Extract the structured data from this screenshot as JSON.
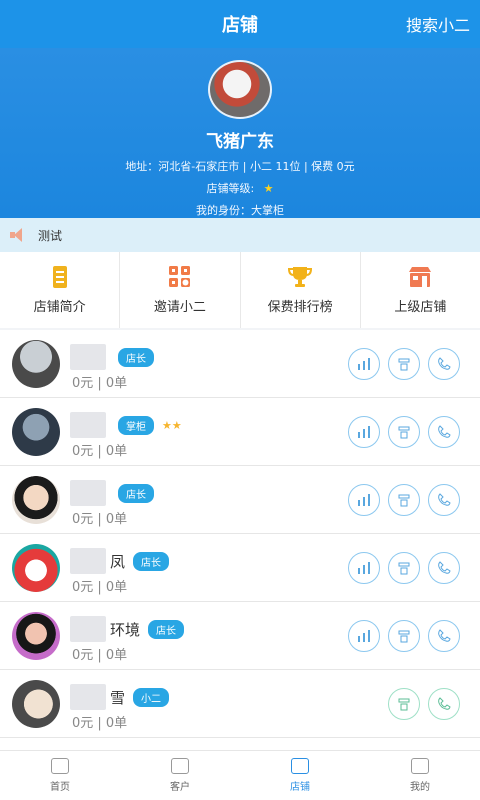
{
  "header": {
    "title": "店铺",
    "right_action": "搜索小二"
  },
  "store": {
    "name": "飞猪广东",
    "address_line": "地址：河北省-石家庄市 | 小二 11位 | 保费 0元",
    "level_label": "店铺等级:",
    "level_star": "★",
    "identity_line": "我的身份：大掌柜"
  },
  "notice": {
    "text": "测试"
  },
  "menu": {
    "items": [
      {
        "label": "店铺简介",
        "icon": "doc-icon",
        "color": "#f0b21d"
      },
      {
        "label": "邀请小二",
        "icon": "qr-icon",
        "color": "#f17b47"
      },
      {
        "label": "保费排行榜",
        "icon": "trophy-icon",
        "color": "#f2b21a"
      },
      {
        "label": "上级店铺",
        "icon": "store-icon",
        "color": "#f07a52"
      }
    ]
  },
  "members": [
    {
      "name_visible": "",
      "role": "店长",
      "stars": "",
      "amount": "0元 | 0单",
      "avatar_colors": [
        "#999",
        "#333"
      ]
    },
    {
      "name_visible": "",
      "role": "掌柜",
      "stars": "★★",
      "amount": "0元 | 0单",
      "avatar_colors": [
        "#8ea1b3",
        "#2e3a48"
      ]
    },
    {
      "name_visible": "",
      "role": "店长",
      "stars": "",
      "amount": "0元 | 0单",
      "avatar_colors": [
        "#f3d8c3",
        "#1b1b1b"
      ]
    },
    {
      "name_visible": "凤",
      "role": "店长",
      "stars": "",
      "amount": "0元 | 0单",
      "avatar_colors": [
        "#e53b3b",
        "#ffffff"
      ]
    },
    {
      "name_visible": "环境",
      "role": "店长",
      "stars": "",
      "amount": "0元 | 0单",
      "avatar_colors": [
        "#c56cc9",
        "#171717"
      ]
    },
    {
      "name_visible": "雪",
      "role": "小二",
      "stars": "",
      "amount": "0元 | 0单",
      "avatar_colors": [
        "#f1e2d2",
        "#4a4a4a"
      ]
    }
  ],
  "tabs": [
    {
      "label": "首页",
      "icon": "home-icon"
    },
    {
      "label": "客户",
      "icon": "customers-icon"
    },
    {
      "label": "店铺",
      "icon": "store-icon"
    },
    {
      "label": "我的",
      "icon": "profile-icon"
    }
  ],
  "colors": {
    "primary": "#1d93e8",
    "notice_bg": "#dceff9",
    "badge": "#29a6e4"
  }
}
